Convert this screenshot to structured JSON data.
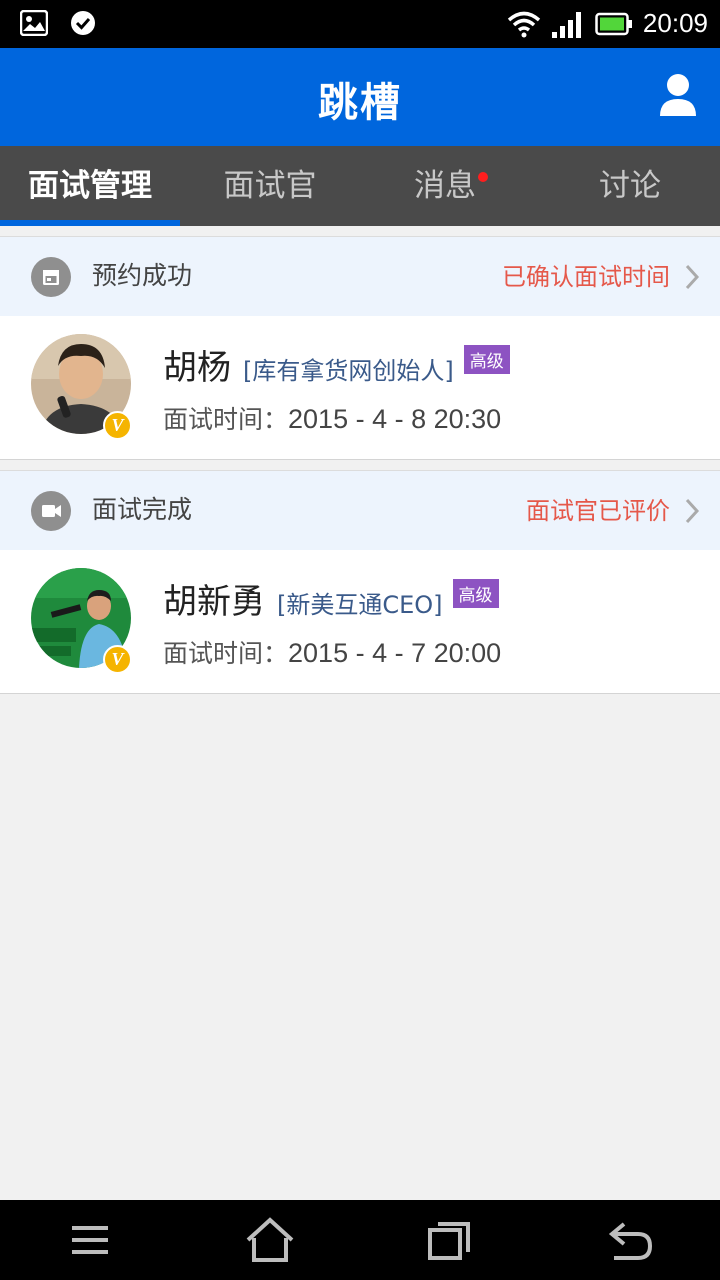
{
  "status_bar": {
    "time": "20:09",
    "icons": [
      "image-icon",
      "check-circle-icon",
      "wifi-icon",
      "signal-icon",
      "battery-icon"
    ]
  },
  "app_bar": {
    "title": "跳槽",
    "user_icon": "user-icon"
  },
  "tabs": [
    {
      "label": "面试管理",
      "active": true
    },
    {
      "label": "面试官",
      "active": false
    },
    {
      "label": "消息",
      "active": false,
      "has_dot": true
    },
    {
      "label": "讨论",
      "active": false
    }
  ],
  "sections": [
    {
      "header": {
        "icon": "calendar-icon",
        "label": "预约成功",
        "status": "已确认面试时间"
      },
      "card": {
        "name": "胡杨",
        "company": "[库有拿货网创始人]",
        "level": "高级",
        "time_label": "面试时间：",
        "time_value": "2015 - 4 - 8  20:30",
        "verified": "V"
      }
    },
    {
      "header": {
        "icon": "video-icon",
        "label": "面试完成",
        "status": "面试官已评价"
      },
      "card": {
        "name": "胡新勇",
        "company": "[新美互通CEO]",
        "level": "高级",
        "time_label": "面试时间：",
        "time_value": "2015 - 4 - 7  20:00",
        "verified": "V"
      }
    }
  ],
  "nav_bar": {
    "icons": [
      "menu-icon",
      "home-icon",
      "recent-apps-icon",
      "back-icon"
    ]
  },
  "colors": {
    "primary": "#0066dd",
    "tab_bg": "#4a4a4a",
    "status_red": "#e5584a",
    "level_purple": "#8d53c2",
    "badge_gold": "#f5b400"
  }
}
